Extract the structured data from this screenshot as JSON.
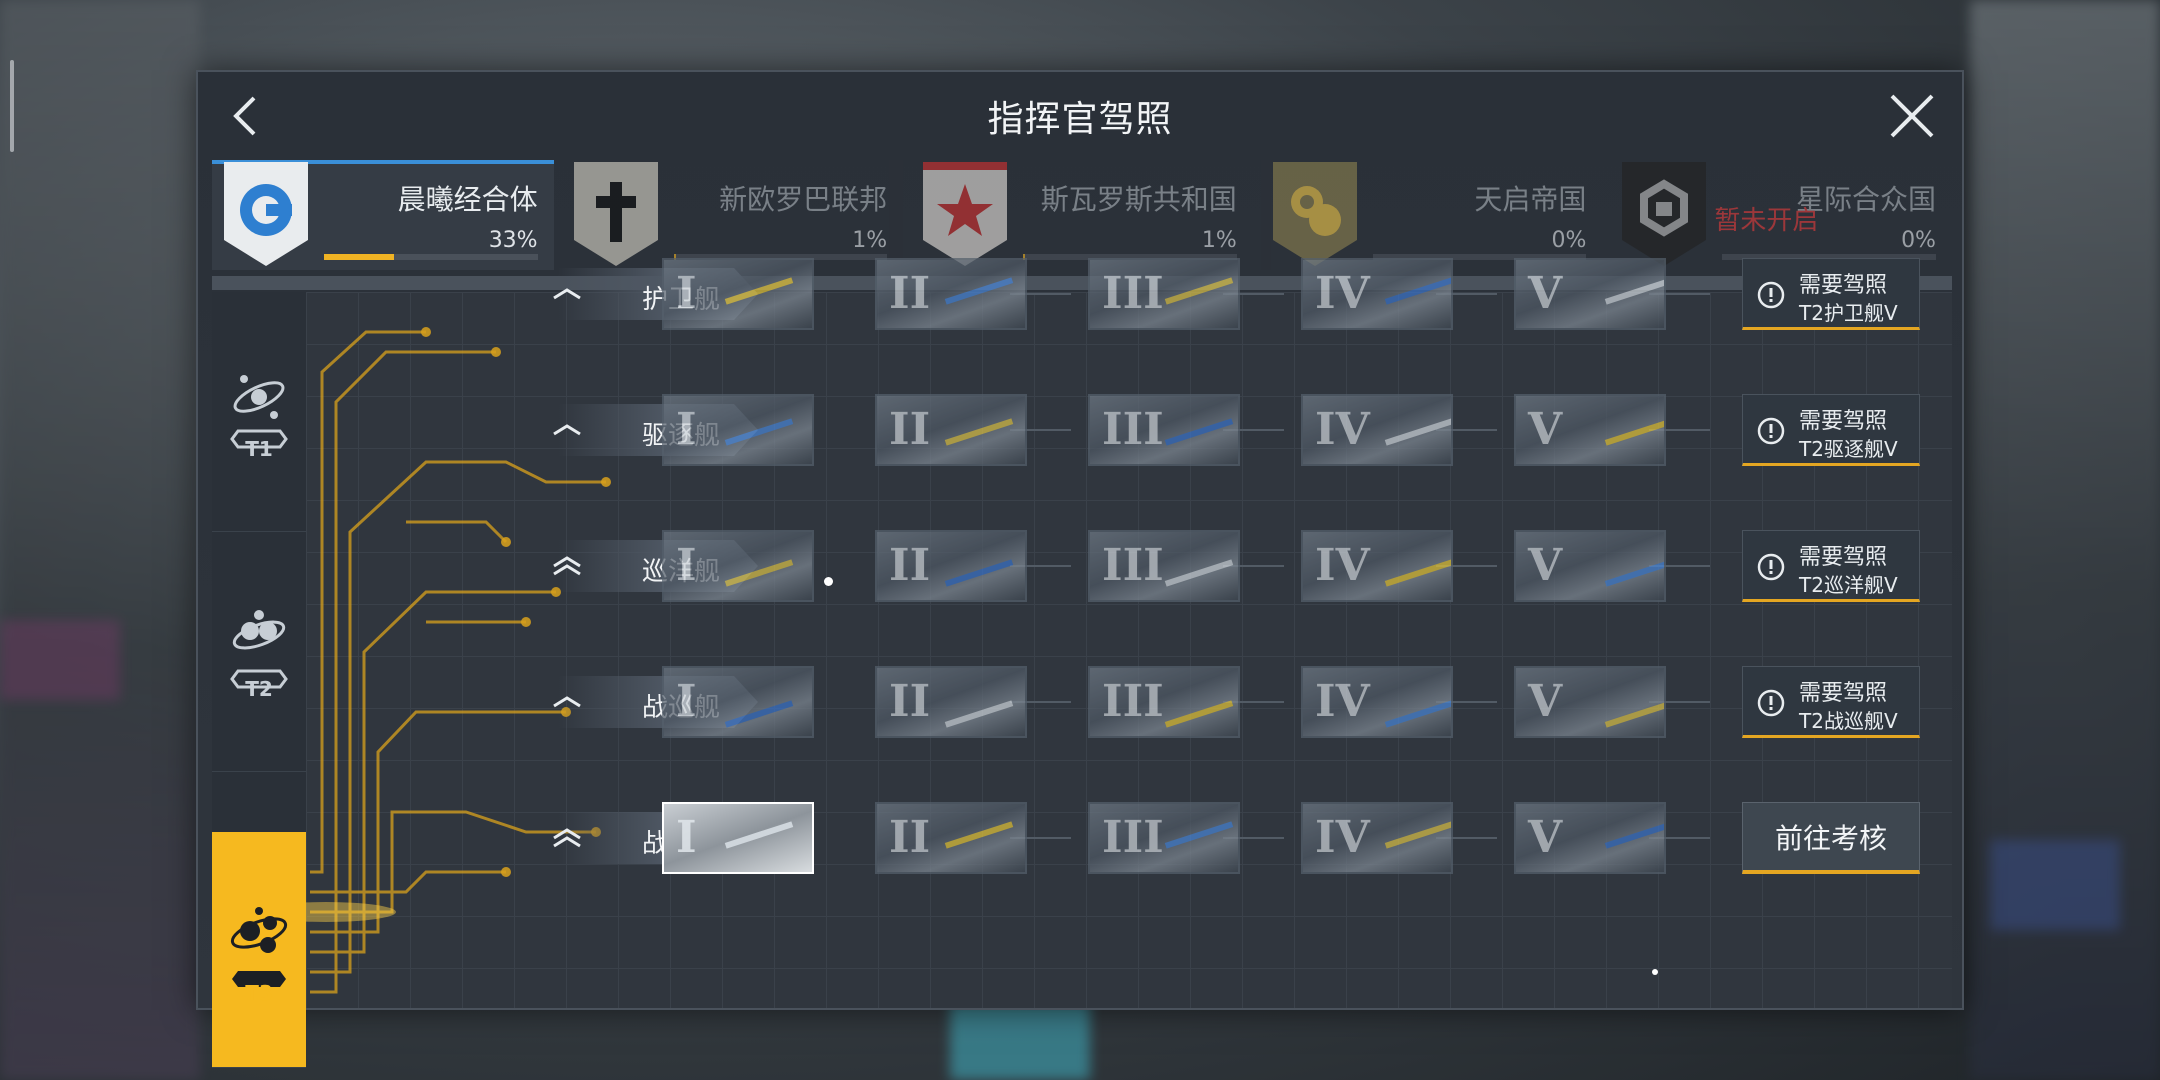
{
  "title": "指挥官驾照",
  "factions": [
    {
      "name": "晨曦经合体",
      "pct": "33%",
      "progress": 0.33,
      "active": true,
      "locked_note": ""
    },
    {
      "name": "新欧罗巴联邦",
      "pct": "1%",
      "progress": 0.01,
      "active": false,
      "locked_note": ""
    },
    {
      "name": "斯瓦罗斯共和国",
      "pct": "1%",
      "progress": 0.01,
      "active": false,
      "locked_note": ""
    },
    {
      "name": "天启帝国",
      "pct": "0%",
      "progress": 0.0,
      "active": false,
      "locked_note": ""
    },
    {
      "name": "星际合众国",
      "pct": "0%",
      "progress": 0.0,
      "active": false,
      "locked_note": "暂未开启"
    }
  ],
  "tiers": [
    "T1",
    "T2",
    "T3"
  ],
  "selected_tier": "T3",
  "rows": [
    {
      "class_name": "护卫舰",
      "chevron": "single",
      "ranks": [
        "I",
        "II",
        "III",
        "IV",
        "V"
      ],
      "requirement": {
        "line1": "需要驾照",
        "line2": "T2护卫舰V"
      }
    },
    {
      "class_name": "驱逐舰",
      "chevron": "single",
      "ranks": [
        "I",
        "II",
        "III",
        "IV",
        "V"
      ],
      "requirement": {
        "line1": "需要驾照",
        "line2": "T2驱逐舰V"
      }
    },
    {
      "class_name": "巡洋舰",
      "chevron": "double",
      "ranks": [
        "I",
        "II",
        "III",
        "IV",
        "V"
      ],
      "requirement": {
        "line1": "需要驾照",
        "line2": "T2巡洋舰V"
      }
    },
    {
      "class_name": "战巡舰",
      "chevron": "single",
      "ranks": [
        "I",
        "II",
        "III",
        "IV",
        "V"
      ],
      "requirement": {
        "line1": "需要驾照",
        "line2": "T2战巡舰V"
      }
    },
    {
      "class_name": "战列舰",
      "chevron": "double",
      "ranks": [
        "I",
        "II",
        "III",
        "IV",
        "V"
      ],
      "action_button": "前往考核",
      "selected_rank": "I"
    }
  ],
  "colors": {
    "accent": "#f6b91f",
    "active_faction": "#3a8fd8",
    "progress": "#f0b323",
    "locked_text": "#e23c3c"
  },
  "icons": {
    "back": "chevron-left-icon",
    "close": "close-x-icon",
    "info": "exclamation-circle-icon"
  }
}
